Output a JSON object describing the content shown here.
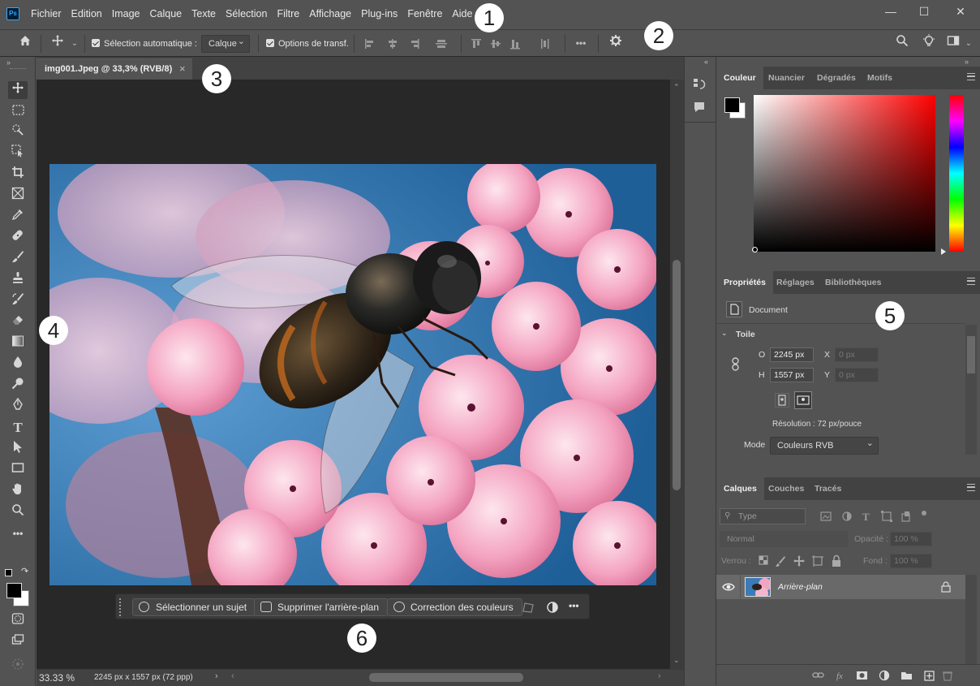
{
  "app": {
    "logo": "Ps",
    "accent": "#31a8ff"
  },
  "menu": [
    "Fichier",
    "Edition",
    "Image",
    "Calque",
    "Texte",
    "Sélection",
    "Filtre",
    "Affichage",
    "Plug-ins",
    "Fenêtre",
    "Aide"
  ],
  "window_controls": {
    "minimize": "—",
    "maximize": "☐",
    "close": "✕"
  },
  "badges": {
    "one": "1",
    "two": "2",
    "three": "3",
    "four": "4",
    "five": "5",
    "six": "6"
  },
  "options": {
    "auto_select_label": "Sélection automatique :",
    "auto_select_value": "Calque",
    "transform_label": "Options de transf.",
    "more_label": "•••"
  },
  "document": {
    "tab_title": "img001.Jpeg @ 33,3% (RVB/8)",
    "close": "×",
    "zoom": "33.33 %",
    "info": "2245 px x 1557 px (72 ppp)"
  },
  "contextual_bar": {
    "select_subject": "Sélectionner un sujet",
    "remove_background": "Supprimer l'arrière-plan",
    "color_correction": "Correction des couleurs",
    "more": "•••"
  },
  "color_panel": {
    "tabs": [
      "Couleur",
      "Nuancier",
      "Dégradés",
      "Motifs"
    ],
    "foreground": "#000000",
    "background": "#ffffff",
    "hue": "#ff0000"
  },
  "properties_panel": {
    "tabs": [
      "Propriétés",
      "Réglages",
      "Bibliothèques"
    ],
    "doc_label": "Document",
    "section": "Toile",
    "w_label": "O",
    "w_value": "2245 px",
    "h_label": "H",
    "h_value": "1557 px",
    "x_label": "X",
    "x_value": "0 px",
    "y_label": "Y",
    "y_value": "0 px",
    "resolution": "Résolution : 72 px/pouce",
    "mode_label": "Mode",
    "mode_value": "Couleurs RVB"
  },
  "layers_panel": {
    "tabs": [
      "Calques",
      "Couches",
      "Tracés"
    ],
    "filter_placeholder": "Type",
    "blend_mode": "Normal",
    "opacity_label": "Opacité :",
    "opacity_value": "100 %",
    "lock_label": "Verrou :",
    "fill_label": "Fond :",
    "fill_value": "100 %",
    "layers": [
      {
        "name": "Arrière-plan",
        "visible": true,
        "locked": true
      }
    ],
    "footer_icons": [
      "link-icon",
      "fx-icon",
      "mask-icon",
      "adjustment-icon",
      "folder-icon",
      "new-layer-icon",
      "trash-icon"
    ]
  },
  "tools": [
    "move-tool",
    "marquee-tool",
    "object-select-tool",
    "crop-tool",
    "frame-tool",
    "eyedropper-tool",
    "healing-tool",
    "brush-tool",
    "stamp-tool",
    "history-brush-tool",
    "eraser-tool",
    "gradient-tool",
    "blur-tool",
    "dodge-tool",
    "pen-tool",
    "type-tool",
    "path-select-tool",
    "rectangle-tool",
    "hand-tool",
    "zoom-tool",
    "more-tools"
  ]
}
